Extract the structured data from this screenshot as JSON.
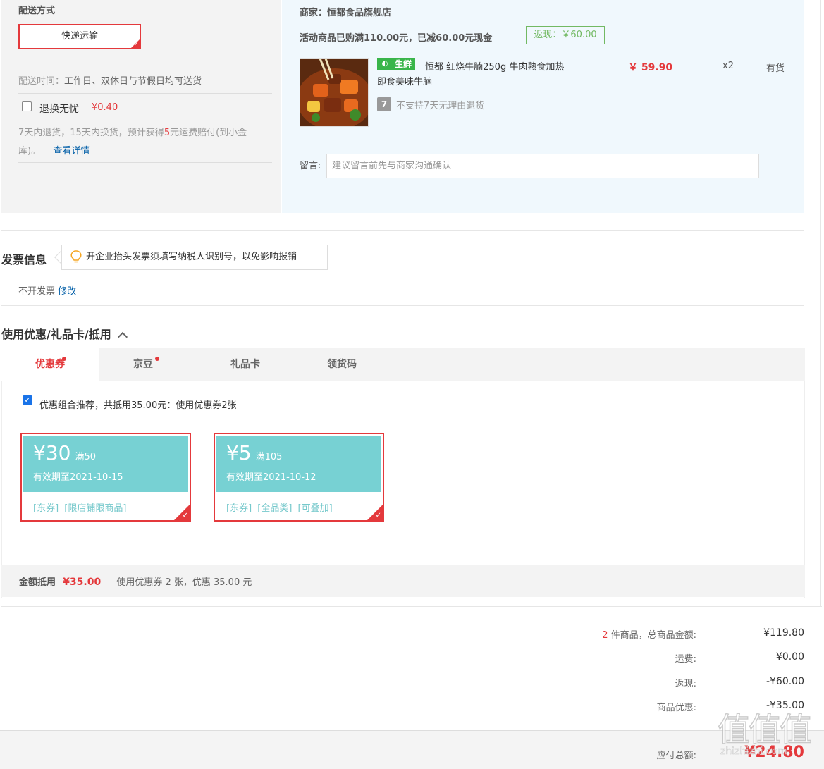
{
  "shipping": {
    "title": "配送方式",
    "method": "快递运输",
    "time_label": "配送时间：",
    "time_value": "工作日、双休日与节假日均可送货",
    "worry_free_label": "退换无忧",
    "worry_free_price": "¥0.40",
    "worry_free_desc_1": "7天内退货，15天内换货，预计获得",
    "worry_free_num": "5",
    "worry_free_desc_2": "元运费赔付(到小金",
    "worry_free_desc_3": "库)。",
    "details_link": "查看详情"
  },
  "merchant": {
    "label": "商家：",
    "name": "恒都食品旗舰店",
    "promo": "活动商品已购满110.00元，已减60.00元现金",
    "cashback": "返现：￥60.00",
    "fresh_tag": "生鲜",
    "product_name_1": "恒都 红烧牛腩250g 牛肉熟食加热",
    "product_name_2": "即食美味牛腩",
    "price": "￥ 59.90",
    "qty": "x2",
    "stock": "有货",
    "return_icon": "7",
    "return_policy": "不支持7天无理由退货",
    "memo_label": "留言:",
    "memo_placeholder": "建议留言前先与商家沟通确认"
  },
  "invoice": {
    "title": "发票信息",
    "tip": "开企业抬头发票须填写纳税人识别号，以免影响报销",
    "status": "不开发票",
    "modify": "修改"
  },
  "discount": {
    "title": "使用优惠/礼品卡/抵用",
    "tabs": [
      "优惠券",
      "京豆",
      "礼品卡",
      "领货码"
    ],
    "recommend": "优惠组合推荐，共抵用35.00元：使用优惠券2张",
    "coupons": [
      {
        "amount": "¥30",
        "cond": "满50",
        "valid": "有效期至2021-10-15",
        "tags": "[东券] [限店铺限商品]"
      },
      {
        "amount": "¥5",
        "cond": "满105",
        "valid": "有效期至2021-10-12",
        "tags": "[东券] [全品类] [可叠加]"
      }
    ],
    "summary_label": "金额抵用",
    "summary_amount": "¥35.00",
    "summary_desc": "使用优惠券 2 张，优惠 35.00 元"
  },
  "totals": {
    "count": "2",
    "count_suffix": " 件商品，总商品金额:",
    "goods_amount": "¥119.80",
    "freight_label": "运费:",
    "freight": "¥0.00",
    "cashback_label": "返现:",
    "cashback": "-¥60.00",
    "discount_label": "商品优惠:",
    "discount": "-¥35.00",
    "payable_label": "应付总额:",
    "payable": "¥24.80"
  },
  "watermark": {
    "glyphs": "值值值",
    "site": "zhizhizhi.com"
  },
  "colors": {
    "accent_red": "#e4393c",
    "coupon_teal": "#77d1d3",
    "fresh_green": "#39b54a",
    "link_blue": "#005ea7"
  }
}
